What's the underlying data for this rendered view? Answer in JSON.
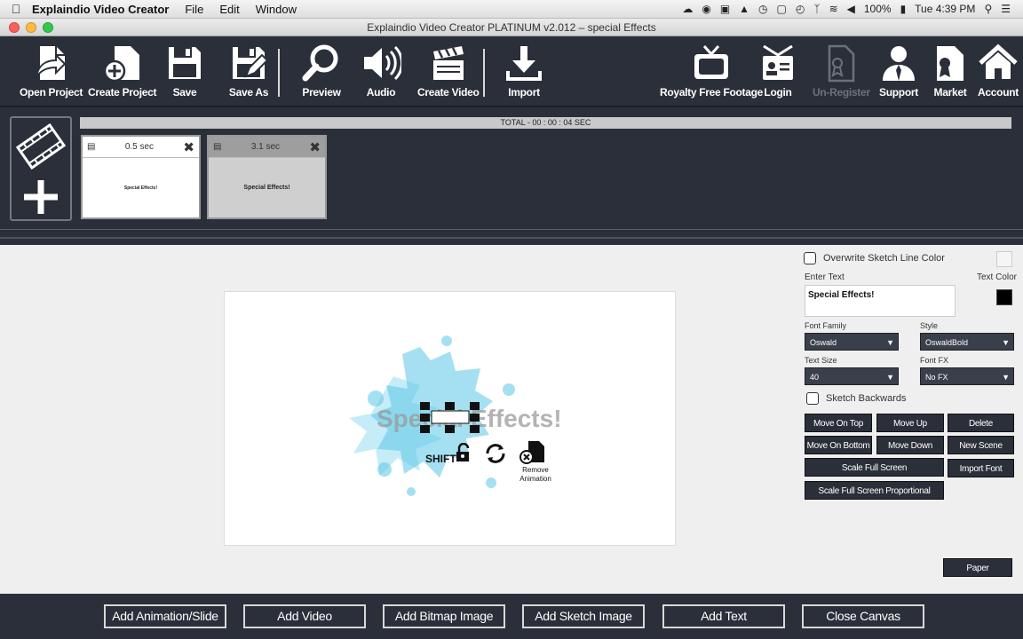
{
  "menubar": {
    "app_name": "Explaindio Video Creator",
    "menus": [
      "File",
      "Edit",
      "Window"
    ],
    "battery": "100%",
    "clock": "Tue 4:39 PM"
  },
  "window": {
    "title": "Explaindio Video Creator PLATINUM v2.012 – special Effects"
  },
  "toolbar": {
    "open_project": "Open Project",
    "create_project": "Create Project",
    "save": "Save",
    "save_as": "Save As",
    "preview": "Preview",
    "audio": "Audio",
    "create_video": "Create Video",
    "import": "Import",
    "royalty_free_footage": "Royalty Free Footage",
    "login": "Login",
    "un_register": "Un-Register",
    "support": "Support",
    "market": "Market",
    "account": "Account"
  },
  "timeline": {
    "total": "TOTAL - 00 : 00 : 04 SEC",
    "scenes": [
      {
        "duration": "0.5 sec",
        "label": "Special Effects!"
      },
      {
        "duration": "3.1 sec",
        "label": "Special Effects!"
      }
    ]
  },
  "canvas": {
    "element_text": "Special Effects!",
    "shift_label": "SHIFT",
    "remove_animation": "Remove Animation",
    "accent": "#5cc8e8"
  },
  "props": {
    "overwrite_color": "Overwrite Sketch Line Color",
    "enter_text_label": "Enter Text",
    "text_value": "Special Effects!",
    "text_color_label": "Text Color",
    "font_family_label": "Font Family",
    "font_family_value": "Oswald",
    "style_label": "Style",
    "style_value": "OswaldBold",
    "text_size_label": "Text Size",
    "text_size_value": "40",
    "font_fx_label": "Font FX",
    "font_fx_value": "No FX",
    "sketch_backwards": "Sketch Backwards",
    "move_on_top": "Move On Top",
    "move_up": "Move Up",
    "delete": "Delete",
    "move_on_bottom": "Move On Bottom",
    "move_down": "Move Down",
    "new_scene": "New Scene",
    "scale_full_screen": "Scale Full Screen",
    "import_font": "Import Font",
    "scale_full_screen_proportional": "Scale Full Screen Proportional",
    "paper": "Paper"
  },
  "bottom": {
    "add_animation": "Add Animation/Slide",
    "add_video": "Add Video",
    "add_bitmap": "Add Bitmap Image",
    "add_sketch": "Add Sketch Image",
    "add_text": "Add Text",
    "close_canvas": "Close Canvas"
  }
}
